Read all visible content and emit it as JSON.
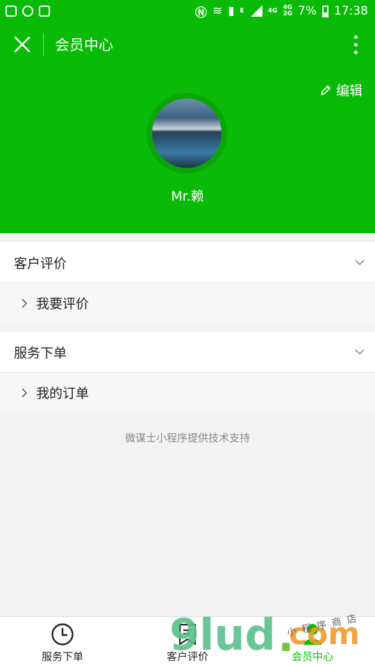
{
  "statusbar": {
    "net_e": "E",
    "net_4g": "4G",
    "net_4g2g_top": "4G",
    "net_4g2g_bottom": "2G",
    "battery": "7%",
    "time": "17:38"
  },
  "navbar": {
    "title": "会员中心"
  },
  "header": {
    "edit_label": "编辑",
    "username": "Mr.赖"
  },
  "sections": [
    {
      "title": "客户评价",
      "items": [
        {
          "label": "我要评价"
        }
      ]
    },
    {
      "title": "服务下单",
      "items": [
        {
          "label": "我的订单"
        }
      ]
    }
  ],
  "footnote": "微谋士小程序提供技术支持",
  "tabs": [
    {
      "label": "服务下单",
      "icon": "clock-icon",
      "active": false
    },
    {
      "label": "客户评价",
      "icon": "review-icon",
      "active": false
    },
    {
      "label": "会员中心",
      "icon": "member-icon",
      "active": true
    }
  ],
  "watermark": {
    "brand": "9lud",
    "dot": ".",
    "tld": "com",
    "tagline": "小程序商店"
  },
  "colors": {
    "brand_green": "#09bb07",
    "avatar_ring": "#0aa506",
    "background": "#f3f3f3"
  }
}
